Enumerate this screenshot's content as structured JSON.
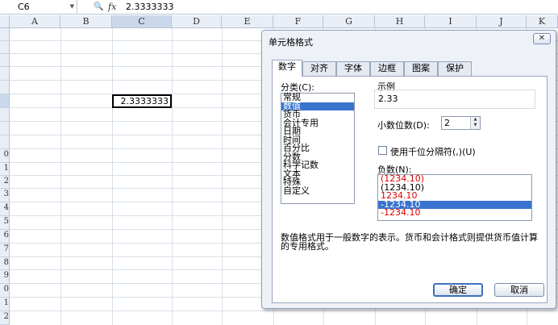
{
  "formula_bar": {
    "name_box": "C6",
    "value": "2.3333333"
  },
  "columns": [
    "A",
    "B",
    "C",
    "D",
    "E",
    "F",
    "G",
    "H",
    "I",
    "J",
    "K"
  ],
  "rows": [
    "",
    "",
    "",
    "",
    "",
    "",
    "",
    "",
    "",
    "",
    "",
    "0",
    "1",
    "2",
    "3",
    "4",
    "5",
    "6",
    "7",
    "8",
    "9",
    "0",
    "1",
    "2"
  ],
  "active_cell": {
    "value": "2.3333333"
  },
  "dialog": {
    "title": "单元格格式",
    "tabs": [
      "数字",
      "对齐",
      "字体",
      "边框",
      "图案",
      "保护"
    ],
    "category_label": "分类(C):",
    "categories": [
      "常规",
      "数值",
      "货币",
      "会计专用",
      "日期",
      "时间",
      "百分比",
      "分数",
      "科学记数",
      "文本",
      "特殊",
      "自定义"
    ],
    "selected_category": "数值",
    "sample_label": "示例",
    "sample_value": "2.33",
    "decimal_label": "小数位数(D):",
    "decimal_value": "2",
    "thousands_label": "使用千位分隔符(,)(U)",
    "thousands_checked": false,
    "negative_label": "负数(N):",
    "negative_options": [
      {
        "text": "(1234.10)",
        "color": "red"
      },
      {
        "text": "(1234.10)",
        "color": "black"
      },
      {
        "text": "1234.10",
        "color": "red"
      },
      {
        "text": "-1234.10",
        "color": "black",
        "selected": true
      },
      {
        "text": "-1234.10",
        "color": "red"
      }
    ],
    "description": "数值格式用于一般数字的表示。货币和会计格式则提供货币值计算的专用格式。",
    "ok_label": "确定",
    "cancel_label": "取消"
  },
  "colors": {
    "selection": "#3a73cf",
    "negative_red": "#e00000",
    "header_bg": "#e9eef6"
  }
}
